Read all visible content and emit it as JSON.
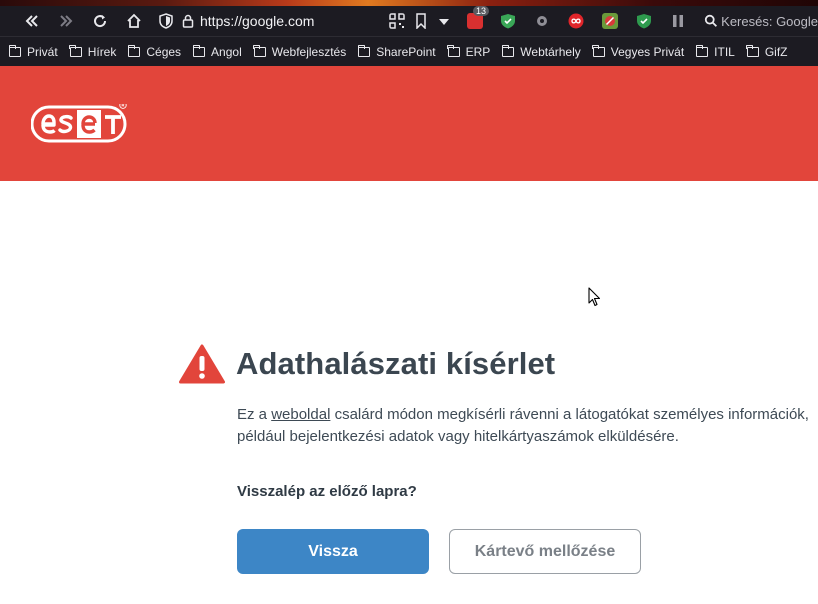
{
  "browser": {
    "url": "https://google.com",
    "notification_badge": "13",
    "search_placeholder": "Keresés: Google",
    "bookmarks": [
      "Privát",
      "Hírek",
      "Céges",
      "Angol",
      "Webfejlesztés",
      "SharePoint",
      "ERP",
      "Webtárhely",
      "Vegyes Privát",
      "ITIL",
      "GifZ"
    ]
  },
  "brand": {
    "logo_text": "eset",
    "banner_color": "#e2453b"
  },
  "warning": {
    "title": "Adathalászati kísérlet",
    "desc_before": "Ez a ",
    "desc_link": "weboldal",
    "desc_after": " csalárd módon megkísérli rávenni a látogatókat személyes információk, például bejelentkezési adatok vagy hitelkártyaszámok elküldésére.",
    "question": "Visszalép az előző lapra?",
    "back_button": "Vissza",
    "ignore_button": "Kártevő mellőzése"
  },
  "colors": {
    "primary_button": "#3d86c6",
    "warning_icon": "#e2453b",
    "title_text": "#3b4650"
  }
}
